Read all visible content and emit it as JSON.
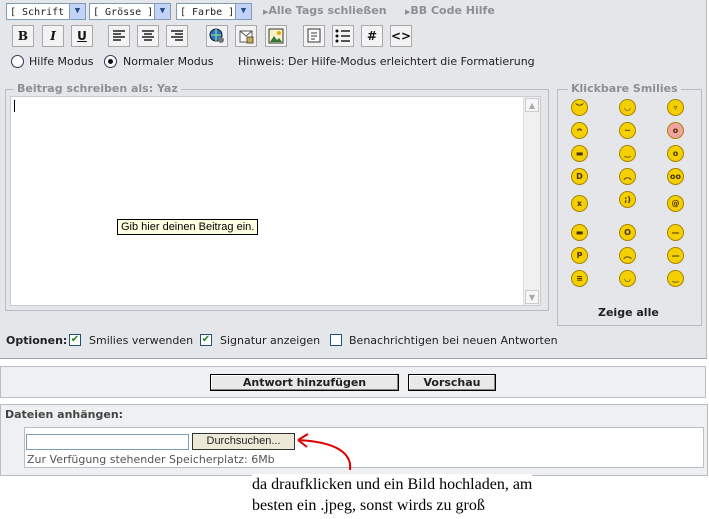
{
  "toolbar": {
    "font_select": "[ Schrift ]",
    "size_select": "[ Grösse ]",
    "color_select": "[ Farbe ]",
    "close_tags": "Alle Tags schließen",
    "bbcode_help": "BB Code Hilfe",
    "bold": "B",
    "italic": "I",
    "underline": "U",
    "hash": "#",
    "code": "<>"
  },
  "mode": {
    "help_mode": "Hilfe Modus",
    "normal_mode": "Normaler Modus",
    "selected": "Normaler Modus",
    "hint": "Hinweis: Der Hilfe-Modus erleichtert die Formatierung"
  },
  "editor": {
    "legend": "Beitrag schreiben als: Yaz",
    "value": "",
    "tooltip": "Gib hier deinen Beitrag ein."
  },
  "smilies": {
    "legend": "Klickbare Smilies",
    "show_all": "Zeige alle",
    "faces": [
      "sad",
      "smile",
      "grin",
      "angry",
      "confused",
      "embarrassed",
      "cool",
      "unsure",
      "surprised",
      "laugh",
      "frown",
      "rolleyes",
      "dead",
      "wink",
      "dizzy",
      "sunglasses",
      "shocked",
      "neutral",
      "tongue",
      "worried",
      "annoyed",
      "grimace",
      "happy",
      "smirk"
    ]
  },
  "options": {
    "label": "Optionen:",
    "smilies": {
      "label": "Smilies verwenden",
      "checked": true
    },
    "signature": {
      "label": "Signatur anzeigen",
      "checked": true
    },
    "notify": {
      "label": "Benachrichtigen bei neuen Antworten",
      "checked": false
    }
  },
  "actions": {
    "submit": "Antwort hinzufügen",
    "preview": "Vorschau"
  },
  "attachments": {
    "heading": "Dateien anhängen:",
    "browse": "Durchsuchen...",
    "quota": "Zur Verfügung stehender Speicherplatz: 6Mb",
    "value": ""
  },
  "annotation": {
    "line1": "da draufklicken und ein Bild hochladen, am",
    "line2": "besten ein .jpeg, sonst wirds zu groß"
  },
  "colors": {
    "panel": "#e4e6e9",
    "smiley": "#f5d000",
    "annotation_arrow": "#e00000"
  }
}
